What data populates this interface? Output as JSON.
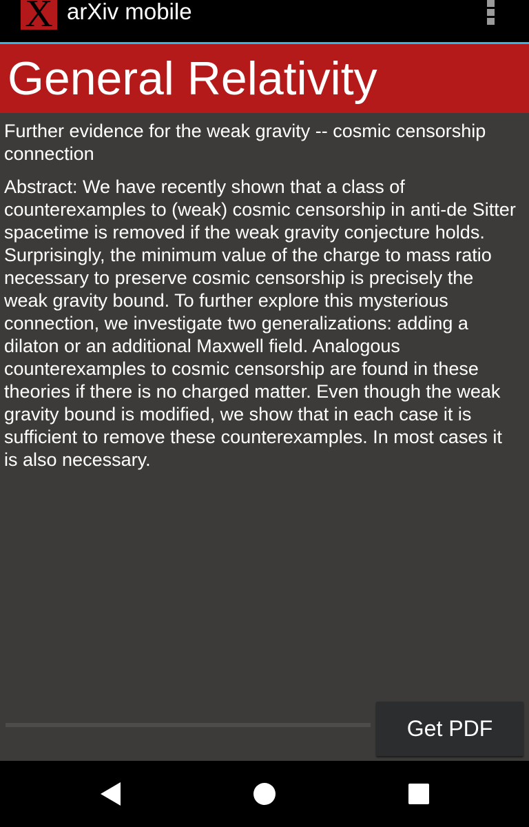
{
  "app_bar": {
    "logo_glyph": "X",
    "title": "arXiv mobile",
    "menu_icon": "overflow-menu-icon",
    "accent_color": "#33b5e5"
  },
  "category": {
    "title": "General Relativity",
    "color": "#b51a1b"
  },
  "paper": {
    "title": "Further evidence for the weak gravity -- cosmic censorship connection",
    "abstract": "Abstract:   We have recently shown that a class of counterexamples to (weak) cosmic censorship in anti-de Sitter spacetime is removed if the weak gravity conjecture holds. Surprisingly, the minimum value of the charge to mass ratio necessary to preserve cosmic censorship is precisely the weak gravity bound. To further explore this mysterious connection, we investigate two generalizations: adding a dilaton or an additional Maxwell field. Analogous counterexamples to cosmic censorship are found in these theories if there is no charged matter. Even though the weak gravity bound is modified, we show that in each case it is sufficient to remove these counterexamples. In most cases it is also necessary."
  },
  "download": {
    "progress_percent": 0,
    "button_label": "Get PDF"
  },
  "nav_bar": {
    "back_icon": "back-triangle-icon",
    "home_icon": "home-circle-icon",
    "recents_icon": "recents-square-icon"
  }
}
